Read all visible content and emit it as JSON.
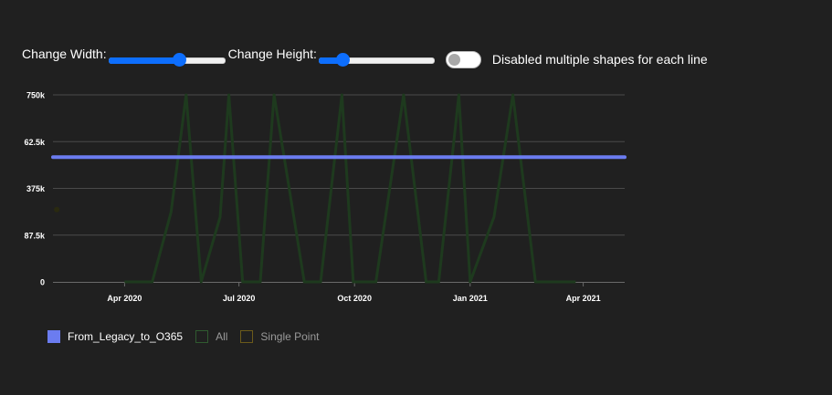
{
  "controls": {
    "width_label": "Change Width:",
    "width_value": 0.62,
    "height_label": "Change Height:",
    "height_value": 0.17,
    "toggle_label": "Disabled multiple shapes for each line",
    "toggle_on": false
  },
  "colors": {
    "background": "#202020",
    "grid": "#4a4a4a",
    "slider_accent": "#0d6efd",
    "series_main": "#6b7cf0",
    "series_all": "#1e3a1e",
    "series_single_point": "#2a2a10"
  },
  "chart_data": {
    "type": "line",
    "title": "",
    "xlabel": "",
    "ylabel": "",
    "xlim": [
      "2020-02-04",
      "2021-05-04"
    ],
    "ylim": [
      0,
      750000
    ],
    "y_tick_labels": [
      "0",
      "87.5k",
      "375k",
      "62.5k",
      "750k"
    ],
    "x_tick_labels": [
      "Apr 2020",
      "Jul 2020",
      "Oct 2020",
      "Jan 2021",
      "Apr 2021"
    ],
    "x_ticks": [
      "2020-04-01",
      "2020-07-01",
      "2020-10-01",
      "2021-01-01",
      "2021-04-01"
    ],
    "grid": true,
    "legend_position": "bottom-left",
    "series": [
      {
        "name": "From_Legacy_to_O365",
        "color": "#6b7cf0",
        "x": [
          "2020-02-04",
          "2021-05-04"
        ],
        "values": [
          500000,
          500000
        ]
      },
      {
        "name": "All",
        "color": "#1e3a1e",
        "x": [
          "2020-04-01",
          "2020-04-23",
          "2020-05-08",
          "2020-05-20",
          "2020-06-01",
          "2020-06-16",
          "2020-06-23",
          "2020-07-04",
          "2020-07-18",
          "2020-07-29",
          "2020-08-22",
          "2020-09-04",
          "2020-09-21",
          "2020-09-30",
          "2020-10-18",
          "2020-11-09",
          "2020-11-27",
          "2020-12-07",
          "2020-12-23",
          "2021-01-01",
          "2021-01-20",
          "2021-02-04",
          "2021-02-22",
          "2021-03-02",
          "2021-03-26"
        ],
        "values": [
          0,
          0,
          280000,
          750000,
          0,
          260000,
          750000,
          0,
          0,
          750000,
          0,
          0,
          750000,
          0,
          0,
          750000,
          0,
          0,
          750000,
          0,
          260000,
          750000,
          0,
          0,
          0
        ]
      },
      {
        "name": "Single Point",
        "color": "#2a2a10",
        "x": [
          "2020-02-07"
        ],
        "values": [
          290000
        ]
      }
    ]
  }
}
